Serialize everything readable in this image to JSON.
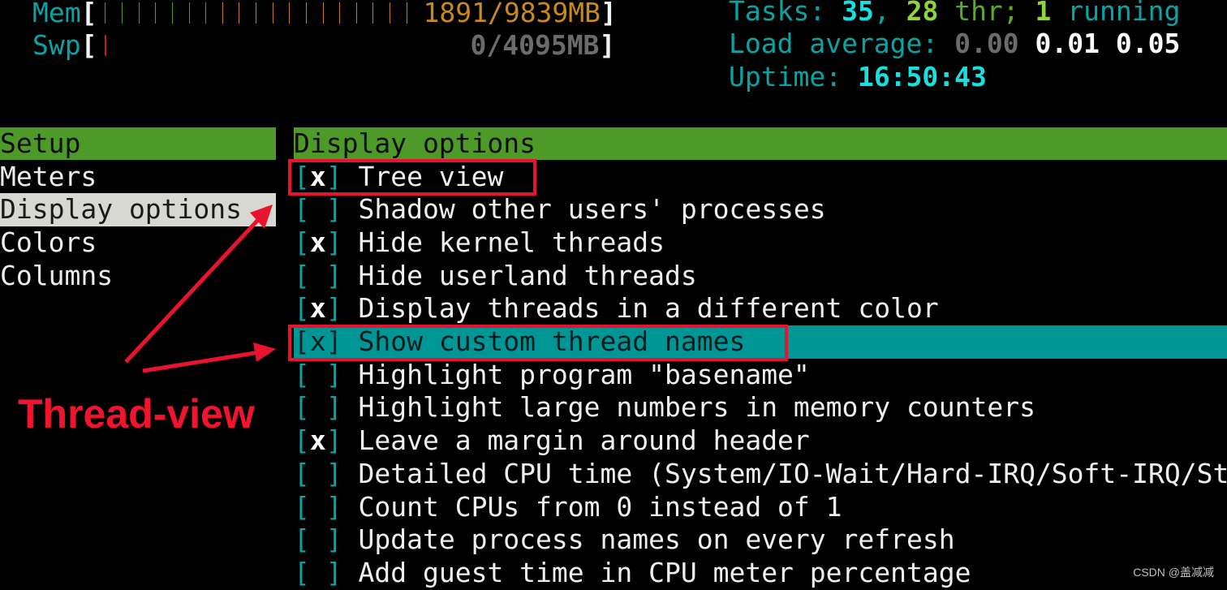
{
  "meters": {
    "mem": {
      "label": "Mem",
      "used_mb": 1891,
      "total_mb": 9839,
      "value_text": "1891/9839MB",
      "bars_green": 7,
      "bars_orange": 12
    },
    "swp": {
      "label": "Swp",
      "used_mb": 0,
      "total_mb": 4095,
      "value_text": "0/4095MB",
      "bars_red": 1
    }
  },
  "stats": {
    "tasks_label": "Tasks: ",
    "tasks": "35",
    "sep": ", ",
    "threads": "28",
    "thr_label": " thr; ",
    "running": "1",
    "running_label": " running",
    "load_label": "Load average: ",
    "load1": "0.00",
    "load5": "0.01",
    "load15": "0.05",
    "uptime_label": "Uptime: ",
    "uptime": "16:50:43"
  },
  "setup": {
    "header": "Setup",
    "items": [
      {
        "label": "Meters",
        "selected": false
      },
      {
        "label": "Display options",
        "selected": true
      },
      {
        "label": "Colors",
        "selected": false
      },
      {
        "label": "Columns",
        "selected": false
      }
    ]
  },
  "display_options": {
    "header": "Display options",
    "options": [
      {
        "label": "Tree view",
        "checked": true,
        "mark": "x"
      },
      {
        "label": "Shadow other users' processes",
        "checked": false,
        "mark": " "
      },
      {
        "label": "Hide kernel threads",
        "checked": true,
        "mark": "x"
      },
      {
        "label": "Hide userland threads",
        "checked": false,
        "mark": " "
      },
      {
        "label": "Display threads in a different color",
        "checked": true,
        "mark": "x"
      },
      {
        "label": "Show custom thread names",
        "checked": true,
        "mark": "x",
        "focused": true
      },
      {
        "label": "Highlight program \"basename\"",
        "checked": false,
        "mark": " "
      },
      {
        "label": "Highlight large numbers in memory counters",
        "checked": false,
        "mark": " "
      },
      {
        "label": "Leave a margin around header",
        "checked": true,
        "mark": "x"
      },
      {
        "label": "Detailed CPU time (System/IO-Wait/Hard-IRQ/Soft-IRQ/Steal/Guest)",
        "checked": false,
        "mark": " "
      },
      {
        "label": "Count CPUs from 0 instead of 1",
        "checked": false,
        "mark": " "
      },
      {
        "label": "Update process names on every refresh",
        "checked": false,
        "mark": " "
      },
      {
        "label": "Add guest time in CPU meter percentage",
        "checked": false,
        "mark": " "
      }
    ]
  },
  "annotation": {
    "label": "Thread-view",
    "color": "#e8132f"
  },
  "watermark": "CSDN @盖减减",
  "colors": {
    "header_green": "#4e9a28",
    "focus_teal": "#019696",
    "selected_gray": "#d8d8d2",
    "text_teal": "#0aa3a3"
  }
}
